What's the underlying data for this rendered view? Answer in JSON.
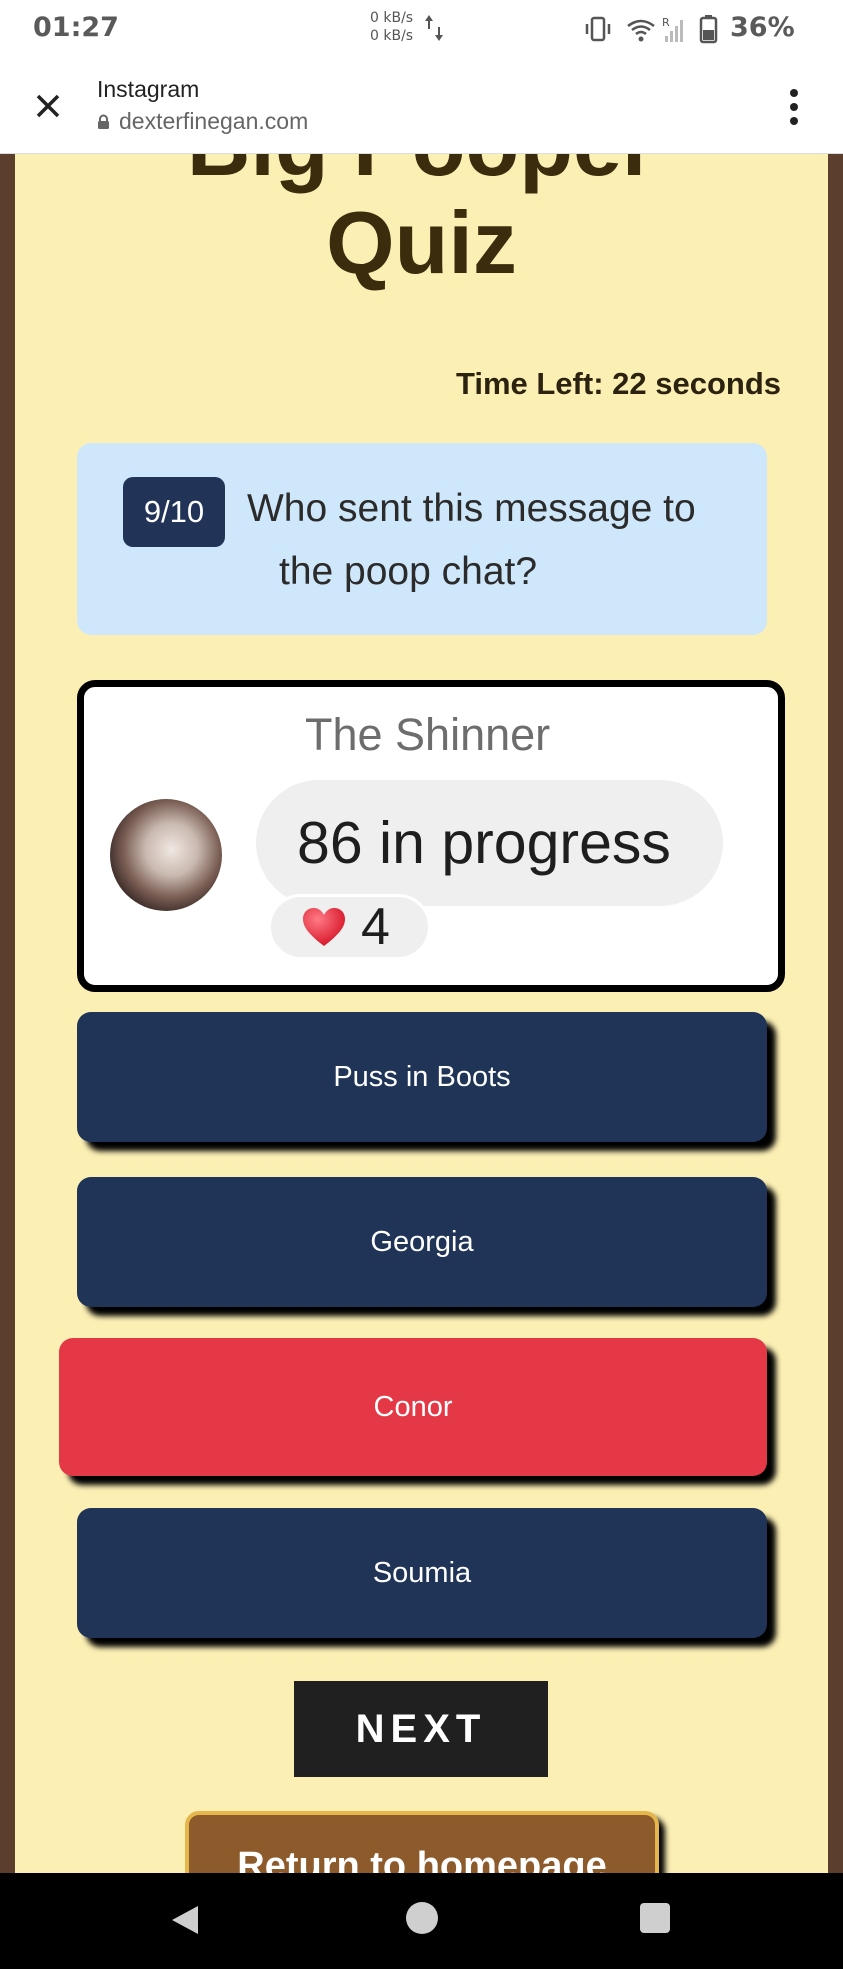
{
  "status_bar": {
    "time": "01:27",
    "net_up": "0 kB/s",
    "net_down": "0 kB/s",
    "battery": "36%",
    "icons": [
      "vibrate-icon",
      "wifi-icon",
      "signal-icon",
      "battery-icon"
    ]
  },
  "browser": {
    "title": "Instagram",
    "url": "dexterfinegan.com"
  },
  "quiz": {
    "title_top": "Big Pooper",
    "title": "Quiz",
    "timer": "Time Left: 22 seconds",
    "progress": "9/10",
    "question_line1": "Who sent this message to",
    "question_line2": "the poop chat?",
    "message": {
      "sender": "The Shinner",
      "text": "86 in progress",
      "reaction_count": "4"
    },
    "answers": [
      {
        "label": "Puss in Boots",
        "state": "default"
      },
      {
        "label": "Georgia",
        "state": "default"
      },
      {
        "label": "Conor",
        "state": "incorrect"
      },
      {
        "label": "Soumia",
        "state": "default"
      }
    ],
    "next_label": "NEXT",
    "home_label": "Return to homepage"
  },
  "colors": {
    "page_bg": "#fcefb4",
    "page_border": "#5b3f2c",
    "answer_default": "#203458",
    "answer_incorrect": "#e53846",
    "question_bg": "#cfe7fb",
    "home_button": "#8d5a2b"
  }
}
